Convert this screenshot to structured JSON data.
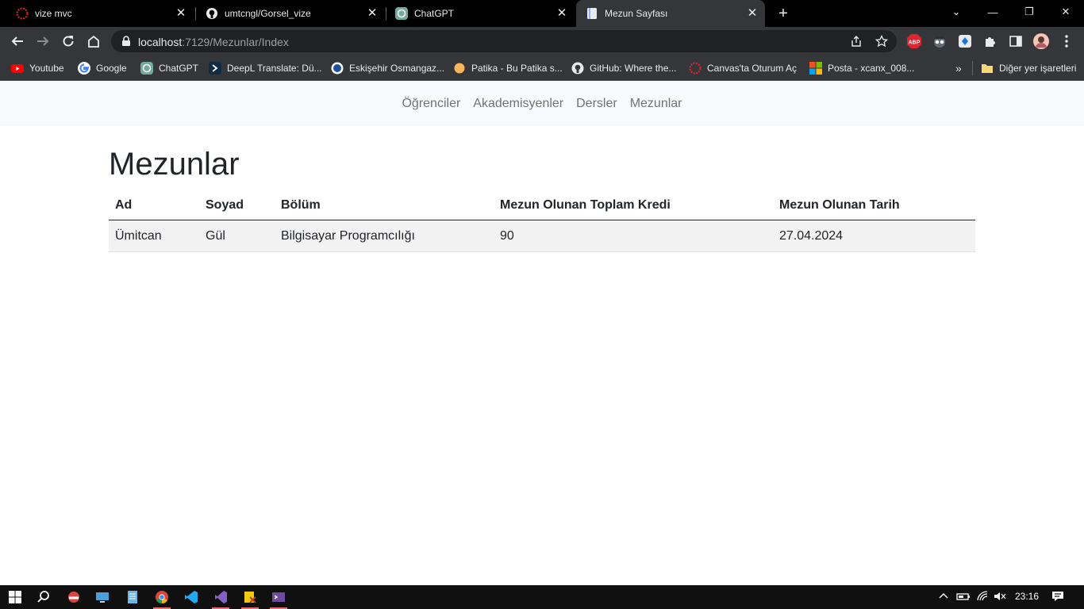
{
  "browser": {
    "tabs": [
      {
        "title": "vize mvc",
        "icon": "canvas-icon"
      },
      {
        "title": "umtcngl/Gorsel_vize",
        "icon": "github-icon"
      },
      {
        "title": "ChatGPT",
        "icon": "chatgpt-icon"
      },
      {
        "title": "Mezun Sayfası",
        "icon": "page-icon",
        "active": true
      }
    ],
    "address": {
      "host": "localhost",
      "path": ":7129/Mezunlar/Index"
    },
    "bookmarks": [
      {
        "label": "Youtube",
        "icon": "youtube-icon"
      },
      {
        "label": "Google",
        "icon": "google-icon"
      },
      {
        "label": "ChatGPT",
        "icon": "chatgpt-icon"
      },
      {
        "label": "DeepL Translate: Dü...",
        "icon": "deepl-icon"
      },
      {
        "label": "Eskişehir Osmangaz...",
        "icon": "university-icon"
      },
      {
        "label": "Patika - Bu Patika s...",
        "icon": "patika-icon"
      },
      {
        "label": "GitHub: Where the...",
        "icon": "github-icon"
      },
      {
        "label": "Canvas'ta Oturum Aç",
        "icon": "canvas-icon"
      },
      {
        "label": "Posta - xcanx_008...",
        "icon": "microsoft-icon"
      }
    ],
    "other_bookmarks": "Diğer yer işaretleri",
    "ext_abp": "ABP"
  },
  "nav": {
    "links": [
      "Öğrenciler",
      "Akademisyenler",
      "Dersler",
      "Mezunlar"
    ]
  },
  "main": {
    "title": "Mezunlar",
    "columns": [
      "Ad",
      "Soyad",
      "Bölüm",
      "Mezun Olunan Toplam Kredi",
      "Mezun Olunan Tarih"
    ],
    "rows": [
      [
        "Ümitcan",
        "Gül",
        "Bilgisayar Programcılığı",
        "90",
        "27.04.2024"
      ]
    ]
  },
  "taskbar": {
    "clock": "23:16"
  }
}
